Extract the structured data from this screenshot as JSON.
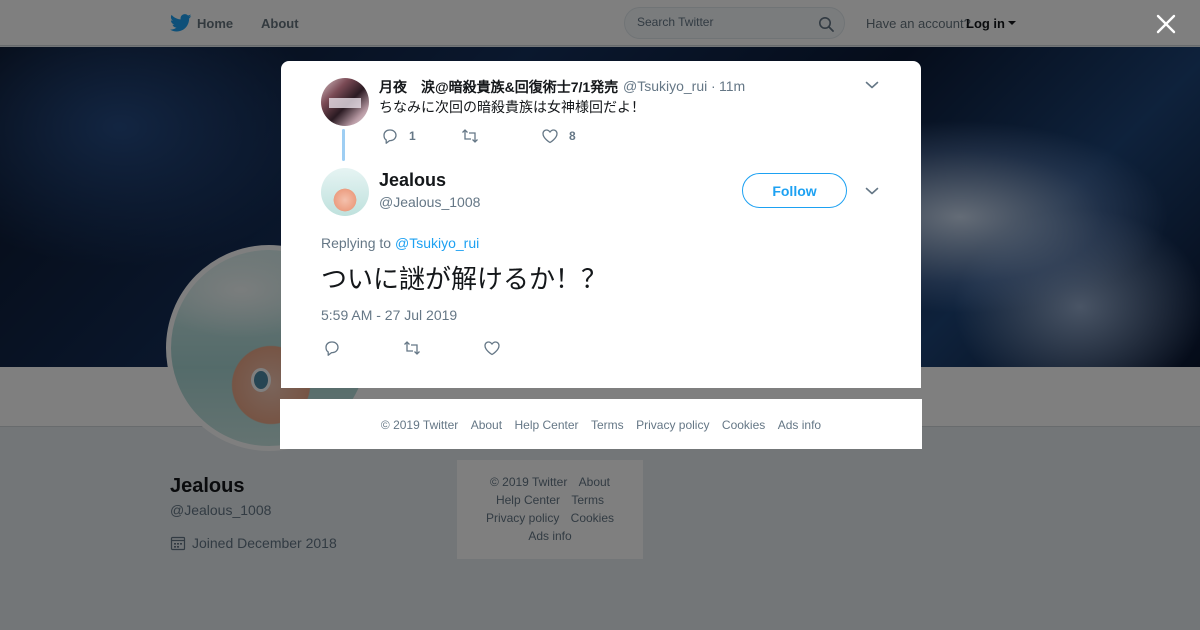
{
  "nav": {
    "home_label": "Home",
    "about_label": "About",
    "search_placeholder": "Search Twitter",
    "account_prompt": "Have an account?",
    "login_label": "Log in"
  },
  "profile": {
    "name": "Jealous",
    "handle": "@Jealous_1008",
    "joined": "Joined December 2018"
  },
  "side_footer": {
    "row1": [
      "© 2019 Twitter",
      "About"
    ],
    "row2": [
      "Help Center",
      "Terms"
    ],
    "row3": [
      "Privacy policy",
      "Cookies"
    ],
    "row4": [
      "Ads info"
    ]
  },
  "context_tweet": {
    "author_name": "月夜　涙@暗殺貴族&回復術士7/1発売",
    "author_handle": "@Tsukiyo_rui",
    "separator": "·",
    "time_ago": "11m",
    "text": "ちなみに次回の暗殺貴族は女神様回だよ！",
    "reply_count": "1",
    "like_count": "8"
  },
  "main_tweet": {
    "author_name": "Jealous",
    "author_handle": "@Jealous_1008",
    "follow_label": "Follow",
    "replying_label": "Replying to",
    "replying_to": "@Tsukiyo_rui",
    "text": "ついに謎が解けるか！？",
    "timestamp": "5:59 AM - 27 Jul 2019"
  },
  "modal_footer": {
    "copyright": "© 2019 Twitter",
    "about": "About",
    "help": "Help Center",
    "terms": "Terms",
    "privacy": "Privacy policy",
    "cookies": "Cookies",
    "ads": "Ads info"
  },
  "colors": {
    "brand_blue": "#1da1f2",
    "text_primary": "#14171a",
    "text_secondary": "#657786",
    "thread_line": "#9ecef3"
  },
  "icons": [
    "twitter-bird-icon",
    "search-icon",
    "calendar-icon",
    "close-icon",
    "chevron-down-icon",
    "reply-icon",
    "retweet-icon",
    "like-icon"
  ]
}
